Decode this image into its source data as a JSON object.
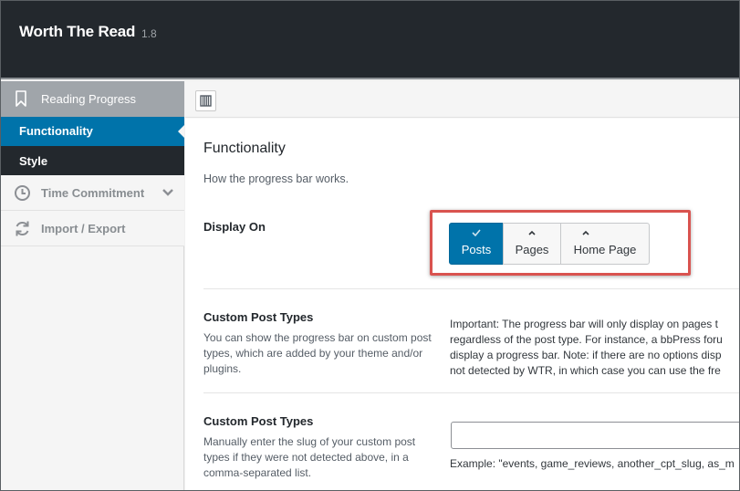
{
  "app": {
    "title": "Worth The Read",
    "version": "1.8"
  },
  "sidebar": {
    "parent": {
      "label": "Reading Progress",
      "icon": "bookmark-icon"
    },
    "active": {
      "label": "Functionality"
    },
    "sub": {
      "label": "Style"
    },
    "items": [
      {
        "label": "Time Commitment",
        "icon": "clock-icon",
        "chevron": "chevron-down-icon"
      },
      {
        "label": "Import / Export",
        "icon": "refresh-icon"
      }
    ]
  },
  "main": {
    "section_title": "Functionality",
    "section_desc": "How the progress bar works.",
    "display_on": {
      "label": "Display On",
      "buttons": [
        {
          "label": "Posts",
          "glyph": "checkmark-icon",
          "selected": true
        },
        {
          "label": "Pages",
          "glyph": "caret-up-icon",
          "selected": false
        },
        {
          "label": "Home Page",
          "glyph": "caret-up-icon",
          "selected": false
        }
      ]
    },
    "custom_post_types": {
      "label": "Custom Post Types",
      "desc": "You can show the progress bar on custom post types, which are added by your theme and/or plugins.",
      "note_lines": [
        "Important: The progress bar will only display on pages t",
        "regardless of the post type. For instance, a bbPress foru",
        "display a progress bar. Note: if there are no options disp",
        "not detected by WTR, in which case you can use the fre"
      ]
    },
    "manual_slugs": {
      "label": "Custom Post Types",
      "desc": "Manually enter the slug of your custom post types if they were not detected above, in a comma-separated list.",
      "input_value": "",
      "example": "Example: \"events, game_reviews, another_cpt_slug, as_m"
    }
  },
  "colors": {
    "header_bg": "#23282d",
    "accent": "#0073aa",
    "highlight": "#d9534f"
  }
}
